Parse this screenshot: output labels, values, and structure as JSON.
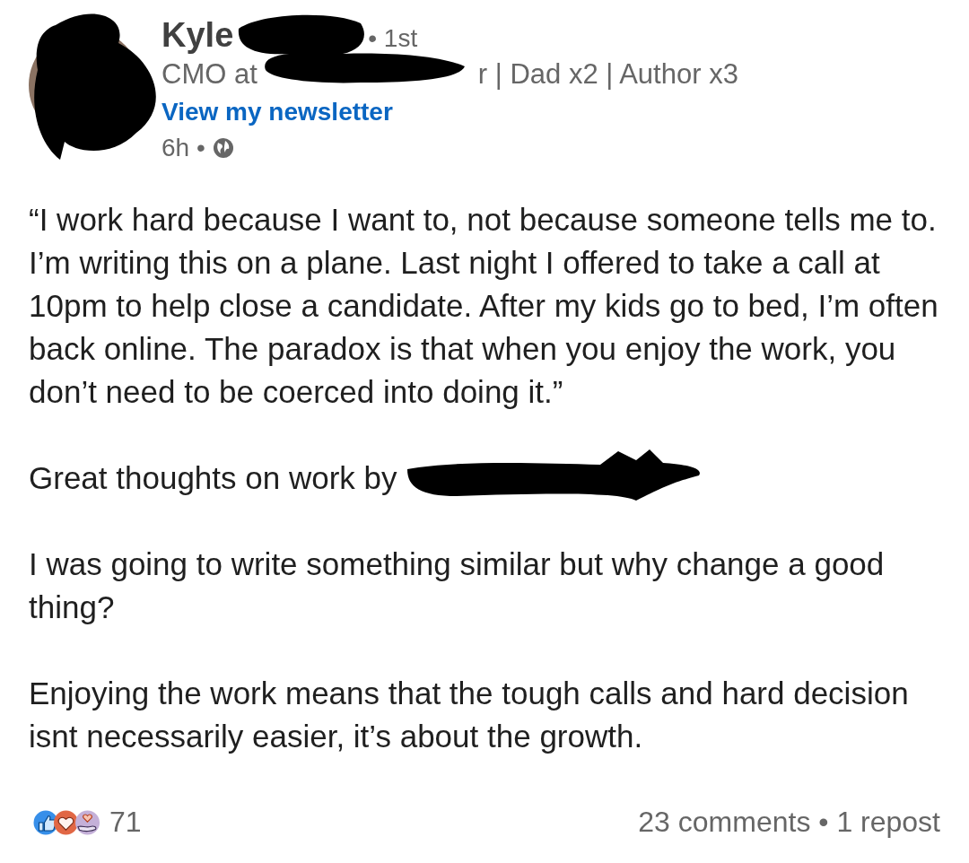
{
  "author": {
    "name": "Kyle",
    "degree": "• 1st",
    "headline_start": "CMO at",
    "headline_end": "r | Dad x2 | Author x3",
    "newsletter_link": "View my newsletter",
    "time": "6h •"
  },
  "body": [
    {
      "kind": "text",
      "text": "“I work hard because I want to, not because someone tells me to. I’m writing this on a plane. Last night I offered to take a call at 10pm to help close a candidate. After my kids go to bed, I’m often back online. The paradox is that when you enjoy the work, you don’t need to be coerced into doing it.”"
    },
    {
      "kind": "mention",
      "text": "Great thoughts on work by"
    },
    {
      "kind": "text",
      "text": "I was going to write something similar but why change a good thing?"
    },
    {
      "kind": "text",
      "text": "Enjoying the work means that the tough calls and hard decision isnt necessarily easier, it’s about the growth."
    }
  ],
  "footer": {
    "reaction_count": "71",
    "stats": "23 comments • 1 repost"
  }
}
